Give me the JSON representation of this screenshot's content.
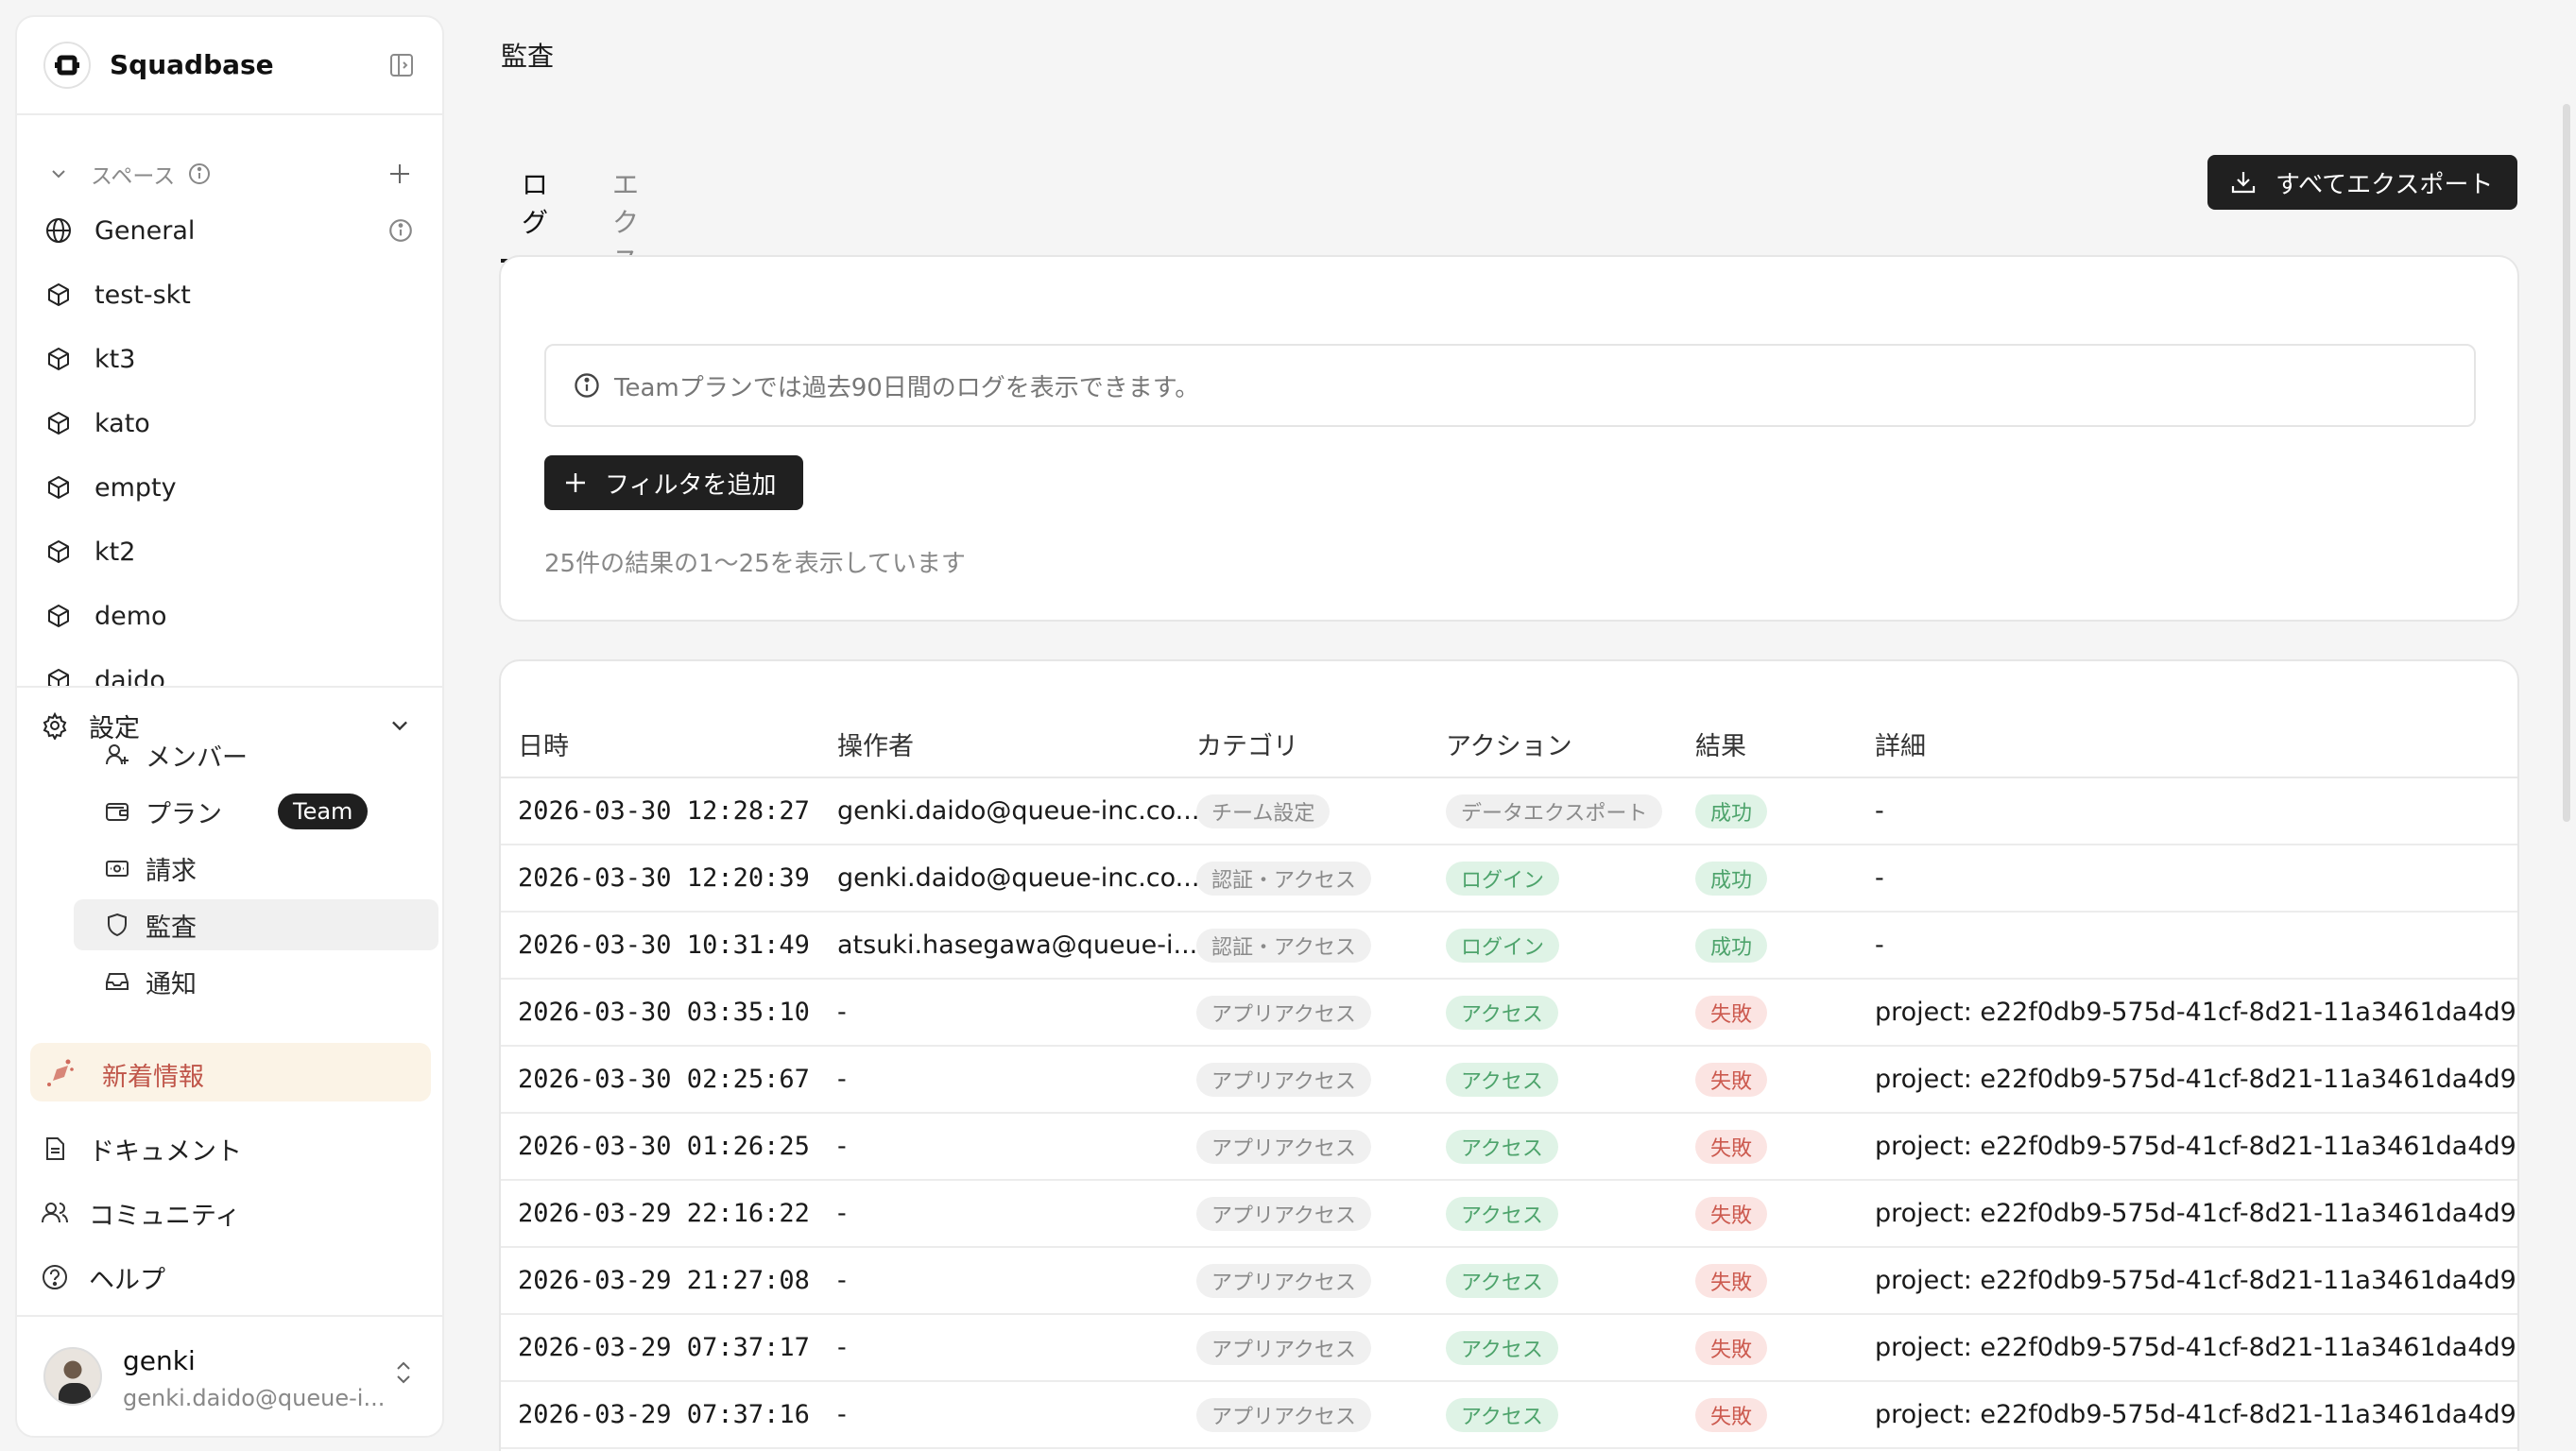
{
  "sidebar": {
    "brand": "Squadbase",
    "space_header": "スペース",
    "spaces": [
      {
        "label": "General",
        "icon": "globe-icon"
      },
      {
        "label": "test-skt",
        "icon": "cube-icon"
      },
      {
        "label": "kt3",
        "icon": "cube-icon"
      },
      {
        "label": "kato",
        "icon": "cube-icon"
      },
      {
        "label": "empty",
        "icon": "cube-icon"
      },
      {
        "label": "kt2",
        "icon": "cube-icon"
      },
      {
        "label": "demo",
        "icon": "cube-icon"
      },
      {
        "label": "daido",
        "icon": "cube-icon"
      }
    ],
    "settings_label": "設定",
    "settings_items": [
      {
        "label": "メンバー",
        "icon": "user-plus-icon"
      },
      {
        "label": "プラン",
        "icon": "wallet-icon",
        "badge": "Team"
      },
      {
        "label": "請求",
        "icon": "billing-icon"
      },
      {
        "label": "監査",
        "icon": "shield-icon",
        "active": true
      },
      {
        "label": "通知",
        "icon": "inbox-icon"
      }
    ],
    "news_label": "新着情報",
    "footer_links": [
      {
        "label": "ドキュメント",
        "icon": "document-icon"
      },
      {
        "label": "コミュニティ",
        "icon": "users-icon"
      },
      {
        "label": "ヘルプ",
        "icon": "help-icon"
      }
    ],
    "user": {
      "name": "genki",
      "email": "genki.daido@queue-i..."
    }
  },
  "page": {
    "title": "監査",
    "tabs": [
      {
        "label": "ログ",
        "active": true
      },
      {
        "label": "エクスポート",
        "active": false
      }
    ],
    "export_all_label": "すべてエクスポート"
  },
  "filter": {
    "info_text": "Teamプランでは過去90日間のログを表示できます。",
    "add_filter_label": "フィルタを追加",
    "result_count": "25件の結果の1〜25を表示しています"
  },
  "table": {
    "columns": [
      "日時",
      "操作者",
      "カテゴリ",
      "アクション",
      "結果",
      "詳細"
    ],
    "rows": [
      {
        "datetime": "2026-03-30 12:28:27",
        "actor": "genki.daido@queue-inc.co...",
        "category": "チーム設定",
        "action": "データエクスポート",
        "result": "成功",
        "result_status": "success",
        "detail": "-"
      },
      {
        "datetime": "2026-03-30 12:20:39",
        "actor": "genki.daido@queue-inc.co...",
        "category": "認証・アクセス",
        "action": "ログイン",
        "result": "成功",
        "result_status": "success",
        "detail": "-"
      },
      {
        "datetime": "2026-03-30 10:31:49",
        "actor": "atsuki.hasegawa@queue-i...",
        "category": "認証・アクセス",
        "action": "ログイン",
        "result": "成功",
        "result_status": "success",
        "detail": "-"
      },
      {
        "datetime": "2026-03-30 03:35:10",
        "actor": "-",
        "category": "アプリアクセス",
        "action": "アクセス",
        "result": "失敗",
        "result_status": "failure",
        "detail": "project: e22f0db9-575d-41cf-8d21-11a3461da4d9"
      },
      {
        "datetime": "2026-03-30 02:25:67",
        "actor": "-",
        "category": "アプリアクセス",
        "action": "アクセス",
        "result": "失敗",
        "result_status": "failure",
        "detail": "project: e22f0db9-575d-41cf-8d21-11a3461da4d9"
      },
      {
        "datetime": "2026-03-30 01:26:25",
        "actor": "-",
        "category": "アプリアクセス",
        "action": "アクセス",
        "result": "失敗",
        "result_status": "failure",
        "detail": "project: e22f0db9-575d-41cf-8d21-11a3461da4d9"
      },
      {
        "datetime": "2026-03-29 22:16:22",
        "actor": "-",
        "category": "アプリアクセス",
        "action": "アクセス",
        "result": "失敗",
        "result_status": "failure",
        "detail": "project: e22f0db9-575d-41cf-8d21-11a3461da4d9"
      },
      {
        "datetime": "2026-03-29 21:27:08",
        "actor": "-",
        "category": "アプリアクセス",
        "action": "アクセス",
        "result": "失敗",
        "result_status": "failure",
        "detail": "project: e22f0db9-575d-41cf-8d21-11a3461da4d9"
      },
      {
        "datetime": "2026-03-29 07:37:17",
        "actor": "-",
        "category": "アプリアクセス",
        "action": "アクセス",
        "result": "失敗",
        "result_status": "failure",
        "detail": "project: e22f0db9-575d-41cf-8d21-11a3461da4d9"
      },
      {
        "datetime": "2026-03-29 07:37:16",
        "actor": "-",
        "category": "アプリアクセス",
        "action": "アクセス",
        "result": "失敗",
        "result_status": "failure",
        "detail": "project: e22f0db9-575d-41cf-8d21-11a3461da4d9"
      }
    ]
  },
  "colors": {
    "accent_dark": "#202020",
    "success": "#4da36b",
    "failure": "#cc5a4f",
    "news": "#c0564a"
  }
}
